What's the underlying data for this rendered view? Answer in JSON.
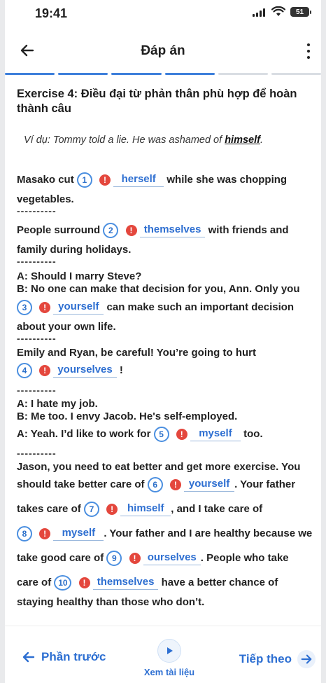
{
  "status": {
    "time": "19:41",
    "battery": "51"
  },
  "header": {
    "title": "Đáp án"
  },
  "progress": {
    "segments": 6,
    "filled": 4
  },
  "exercise": {
    "title": "Exercise 4: Điều đại từ phản thân phù hợp để hoàn thành câu",
    "example_prefix": "Ví dụ: Tommy told a lie. He was ashamed of ",
    "example_answer": "himself",
    "example_suffix": "."
  },
  "separator": "----------",
  "questions": {
    "q1_before": "Masako cut",
    "q1_num": "1",
    "q1_ans": "herself",
    "q1_after": "while she was chopping",
    "q1_line2": "vegetables.",
    "q2_before": "People surround",
    "q2_num": "2",
    "q2_ans": "themselves",
    "q2_after": "with friends and",
    "q2_line2": "family during holidays.",
    "q3_line1": "A: Should I marry Steve?",
    "q3_line2": "B: No one can make that decision for you, Ann. Only you",
    "q3_num": "3",
    "q3_ans": "yourself",
    "q3_after": "can make such an important decision",
    "q3_line4": "about your own life.",
    "q4_line1": "Emily and Ryan, be careful! You’re going to hurt",
    "q4_num": "4",
    "q4_ans": "yourselves",
    "q4_after": "!",
    "q5_line1": "A: I hate my job.",
    "q5_line2": "B: Me too. I envy Jacob. He's self-employed.",
    "q5_before": "A: Yeah. I’d like to work for",
    "q5_num": "5",
    "q5_ans": "myself",
    "q5_after": "too.",
    "q6_line1": "Jason, you need to eat better and get more exercise. You",
    "q6_before": "should take better care of",
    "q6_num": "6",
    "q6_ans": "yourself",
    "q6_after": ". Your father",
    "q7_before": "takes care of",
    "q7_num": "7",
    "q7_ans": "himself",
    "q7_after": ", and I take care of",
    "q8_num": "8",
    "q8_ans": "myself",
    "q8_after": ". Your father and I are healthy because we",
    "q9_before": "take good care of",
    "q9_num": "9",
    "q9_ans": "ourselves",
    "q9_after": ". People who take",
    "q10_before": "care of",
    "q10_num": "10",
    "q10_ans": "themselves",
    "q10_after": "have a better chance of",
    "q10_line2": "staying healthy than those who don’t."
  },
  "bottom": {
    "prev_label": "Phần trước",
    "doc_label": "Xem tài liệu",
    "next_label": "Tiếp theo"
  },
  "colors": {
    "accent": "#2d6fd2",
    "warning": "#e4473d",
    "progress_filled": "#3d7fdb",
    "progress_empty": "#d9dde3"
  }
}
